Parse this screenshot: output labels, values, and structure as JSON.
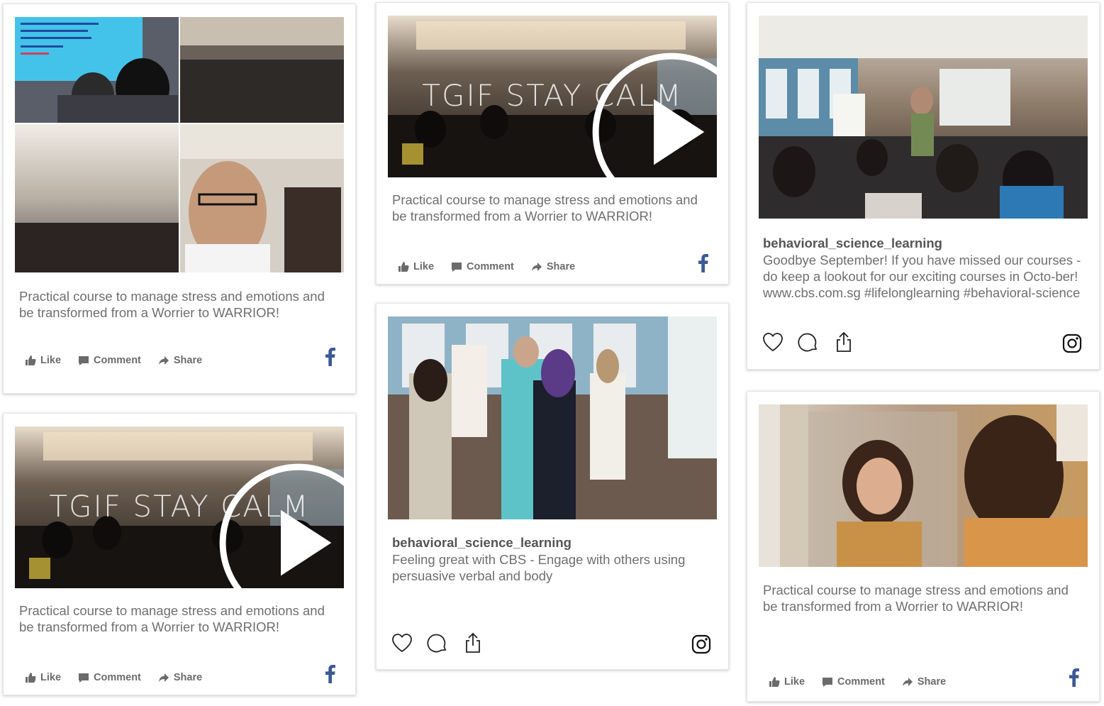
{
  "posts": [
    {
      "caption": "Practical course to manage stress and emotions and be transformed from a Worrier to WARRIOR!",
      "actions": {
        "like": "Like",
        "comment": "Comment",
        "share": "Share"
      },
      "network": "facebook-icon"
    },
    {
      "caption": "Practical course to manage stress and emotions and be transformed from a Worrier to WARRIOR!",
      "actions": {
        "like": "Like",
        "comment": "Comment",
        "share": "Share"
      },
      "network": "facebook-icon",
      "video_overlay": "TGIF STAY CALM"
    },
    {
      "caption": "Practical course to manage stress and emotions and be transformed from a Worrier to WARRIOR!",
      "actions": {
        "like": "Like",
        "comment": "Comment",
        "share": "Share"
      },
      "network": "facebook-icon",
      "video_overlay": "TGIF STAY CALM"
    },
    {
      "username": "behavioral_science_learning",
      "caption": "Feeling great with CBS - Engage with others using persuasive verbal and body",
      "network": "instagram-icon"
    },
    {
      "username": "behavioral_science_learning",
      "caption": "Goodbye September! If you have missed our courses - do keep a lookout for our exciting courses in Octo-ber! www.cbs.com.sg #lifelonglearning #behavioral-science",
      "network": "instagram-icon"
    },
    {
      "caption": "Practical course to manage stress and emotions and be transformed from a Worrier to WARRIOR!",
      "actions": {
        "like": "Like",
        "comment": "Comment",
        "share": "Share"
      },
      "network": "facebook-icon"
    }
  ],
  "colors": {
    "facebook": "#3b5998",
    "caption": "#6f6f6f",
    "action": "#6b6b6b"
  }
}
